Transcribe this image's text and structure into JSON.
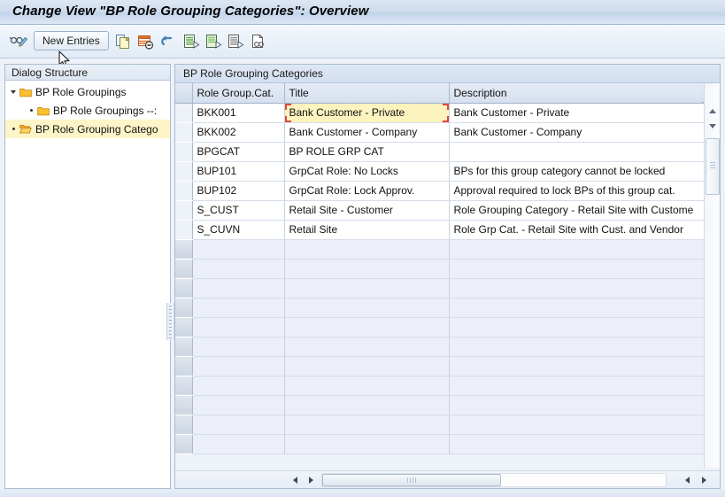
{
  "window": {
    "title": "Change View \"BP Role Grouping Categories\": Overview"
  },
  "toolbar": {
    "display_change_icon": "glasses-pencil-icon",
    "new_entries_label": "New Entries",
    "buttons": [
      {
        "name": "copy-as-button",
        "icon": "copy-icon"
      },
      {
        "name": "delete-button",
        "icon": "delete-row-icon"
      },
      {
        "name": "undo-button",
        "icon": "undo-arrow-icon"
      },
      {
        "name": "select-all-button",
        "icon": "select-all-icon"
      },
      {
        "name": "deselect-all-button",
        "icon": "deselect-all-icon"
      },
      {
        "name": "select-block-button",
        "icon": "select-block-icon"
      },
      {
        "name": "find-button",
        "icon": "binoculars-page-icon"
      }
    ]
  },
  "sidebar": {
    "header": "Dialog Structure",
    "items": [
      {
        "label": "BP Role Groupings",
        "level": 0,
        "expanded": true,
        "selected": false,
        "icon": "folder-closed-icon"
      },
      {
        "label": "BP Role Groupings --:",
        "level": 1,
        "expanded": false,
        "selected": false,
        "icon": "folder-closed-icon"
      },
      {
        "label": "BP Role Grouping Catego",
        "level": 0,
        "expanded": false,
        "selected": true,
        "icon": "folder-open-icon"
      }
    ]
  },
  "main": {
    "header": "BP Role Grouping Categories",
    "columns": [
      "Role Group.Cat.",
      "Title",
      "Description"
    ],
    "config_icon": "column-settings-icon",
    "rows": [
      {
        "code": "BKK001",
        "title": "Bank Customer - Private",
        "description": "Bank Customer - Private"
      },
      {
        "code": "BKK002",
        "title": "Bank Customer - Company",
        "description": "Bank Customer - Company"
      },
      {
        "code": "BPGCAT",
        "title": "BP ROLE GRP CAT",
        "description": ""
      },
      {
        "code": "BUP101",
        "title": "GrpCat Role: No Locks",
        "description": "BPs for this group category cannot be locked"
      },
      {
        "code": "BUP102",
        "title": "GrpCat Role: Lock Approv.",
        "description": "Approval required to lock BPs of this group cat."
      },
      {
        "code": "S_CUST",
        "title": "Retail Site - Customer",
        "description": "Role Grouping Category - Retail Site with Custome"
      },
      {
        "code": "S_CUVN",
        "title": "Retail Site",
        "description": "Role Grp Cat. - Retail Site with Cust. and Vendor"
      }
    ],
    "empty_row_count": 11,
    "selected_cell": {
      "row": 0,
      "column": 1
    }
  },
  "colors": {
    "selection_highlight": "#fdf3bf",
    "selection_border": "#e2443b",
    "tree_selection": "#fdf5c8",
    "header_blue": "#d6e0ee"
  }
}
